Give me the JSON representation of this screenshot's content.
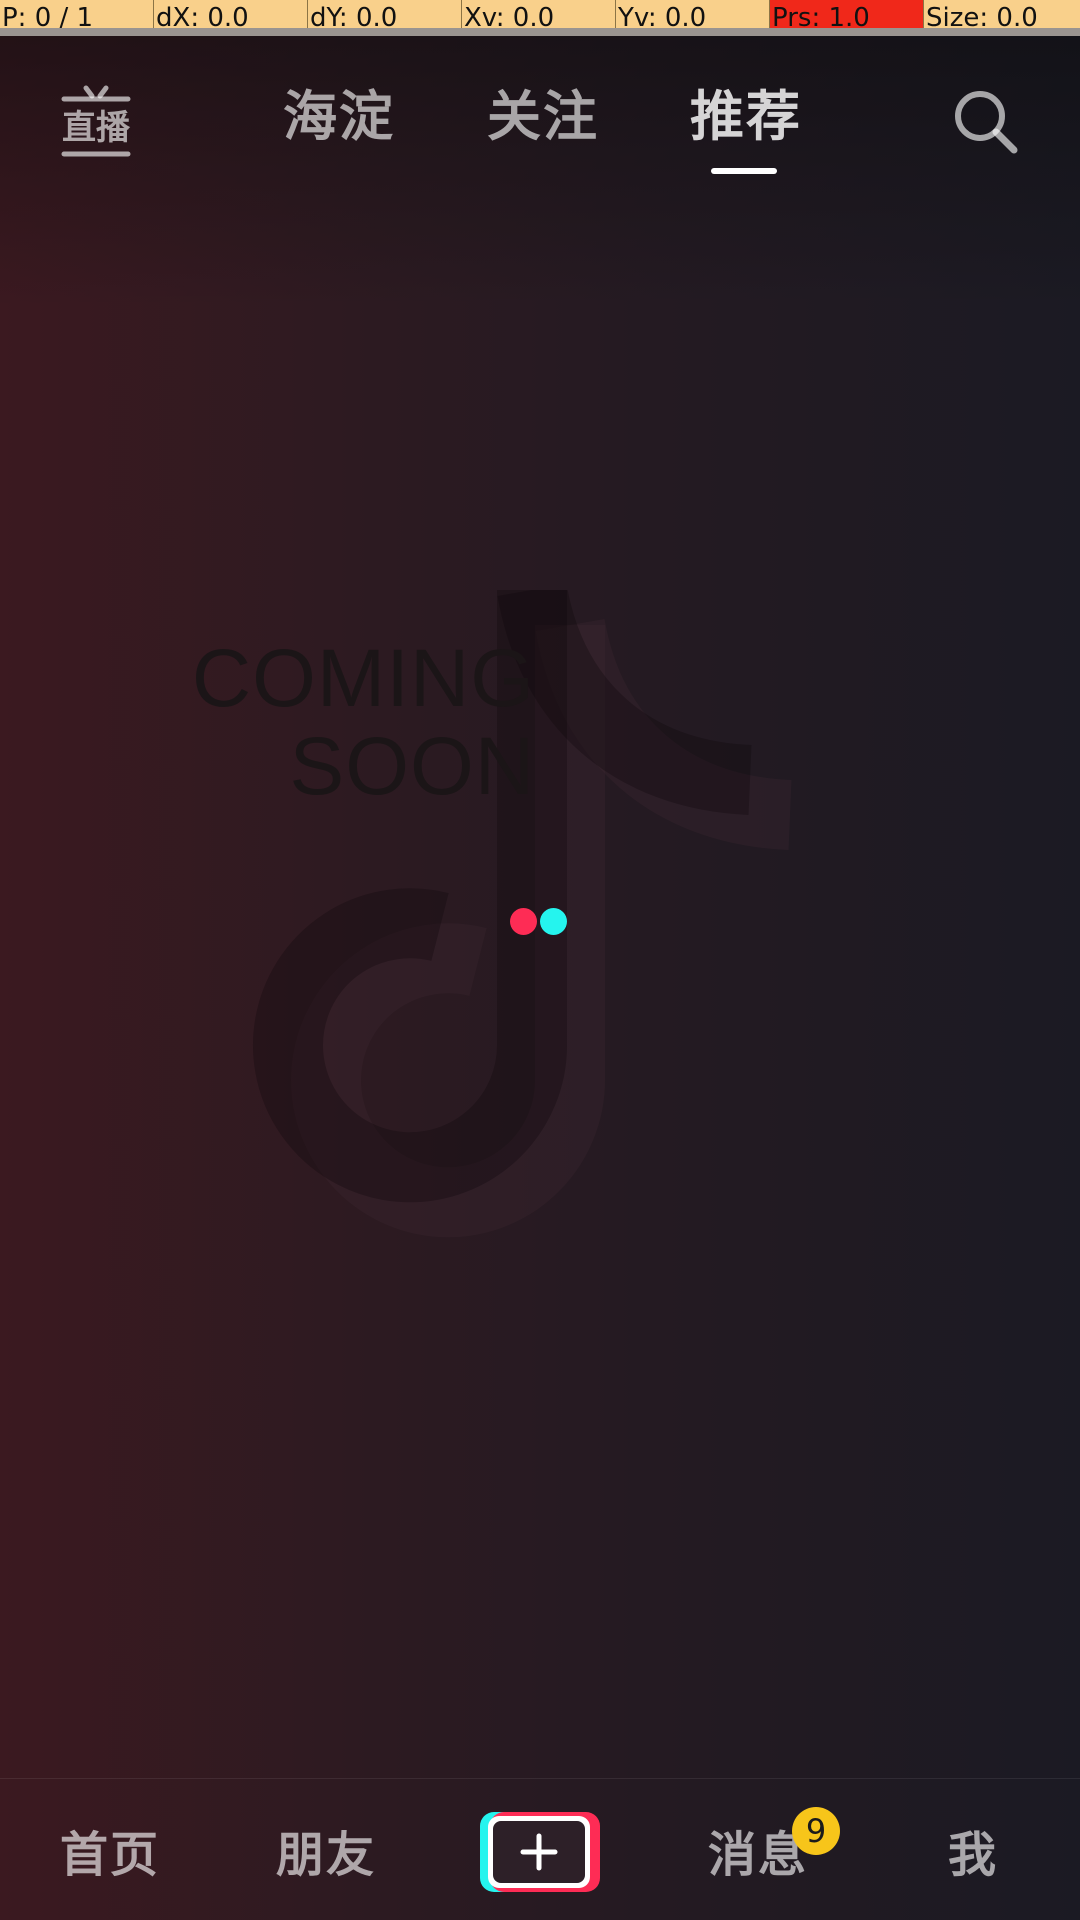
{
  "debug": {
    "pointer": "P: 0 / 1",
    "dx": "dX: 0.0",
    "dy": "dY: 0.0",
    "xv": "Xv: 0.0",
    "yv": "Yv: 0.0",
    "prs": "Prs: 1.0",
    "size": "Size: 0.0"
  },
  "top_nav": {
    "live_label": "直播",
    "tabs": [
      {
        "label": "海淀"
      },
      {
        "label": "关注"
      },
      {
        "label": "推荐"
      }
    ],
    "active_tab": "推荐"
  },
  "placeholder": {
    "line1": "COMING",
    "line2": "SOON"
  },
  "bottom_nav": {
    "items": [
      {
        "label": "首页"
      },
      {
        "label": "朋友"
      },
      {
        "label": "消息"
      },
      {
        "label": "我"
      }
    ],
    "create_icon": "plus-icon",
    "messages_badge": "9"
  },
  "colors": {
    "accent_red": "#fe2c55",
    "accent_cyan": "#25f4ee",
    "badge": "#f7c51a",
    "debug_bg": "#f9d08b",
    "debug_hot": "#f0281a"
  }
}
